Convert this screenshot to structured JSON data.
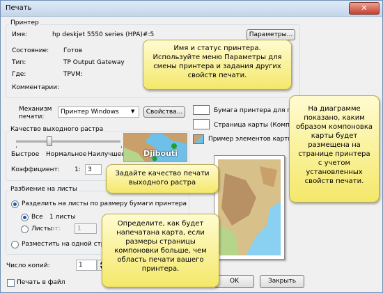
{
  "window": {
    "title": "Печать",
    "close_icon": "close-icon"
  },
  "printer": {
    "section_title": "Принтер",
    "name_label": "Имя:",
    "name_value": "hp deskjet 5550 series (HPA)#:5",
    "properties_button": "Параметры...",
    "status_label": "Состояние:",
    "status_value": "Готов",
    "type_label": "Тип:",
    "type_value": "TP Output Gateway",
    "where_label": "Где:",
    "where_value": "TPVM:",
    "comment_label": "Комментарии:"
  },
  "engine": {
    "label_line1": "Механизм",
    "label_line2": "печати:",
    "selected": "Принтер Windows",
    "properties_button": "Свойства..."
  },
  "raster": {
    "section_title": "Качество выходного растра",
    "ticks": [
      "Быстрое",
      "Нормальное",
      "Наилучшее"
    ],
    "coef_label": "Коэффициент:",
    "coef_prefix": "1:",
    "coef_value": "3",
    "slider_level": 0.3
  },
  "preview": {
    "map_label": "Djibouti"
  },
  "legend": {
    "paper": "Бумага принтера для печати",
    "page": "Страница карты (Компоновка)",
    "sample": "Пример элементов карты"
  },
  "tiling": {
    "section_title": "Разбиение на листы",
    "option_paper": "Разделить на листы по размеру бумаги принтера",
    "all_label": "Все",
    "all_value": "1 листы",
    "sheets_label": "Листы",
    "from_label": "от:",
    "from_value": "1",
    "option_fit": "Разместить на одной странице"
  },
  "copies": {
    "label": "Число копий:",
    "value": "1"
  },
  "print_to_file": "Печать в файл",
  "buttons": {
    "ok": "OK",
    "close": "Закрыть"
  },
  "callouts": {
    "printer": "Имя и статус принтера. Используйте меню Параметры для смены принтера и задания других свойств печати.",
    "raster": "Задайте качество печати выходного растра",
    "tiling": "Определите, как будет напечатана карта, если размеры страницы компоновки больше, чем область печати вашего принтера.",
    "diagram": "На диаграмме показано, каким образом компоновка карты будет размещена на странице принтера с учетом установленных свойств печати."
  },
  "colors": {
    "accent": "#1f57a8",
    "callout": "#f4e86a",
    "green": "#22a02a"
  }
}
